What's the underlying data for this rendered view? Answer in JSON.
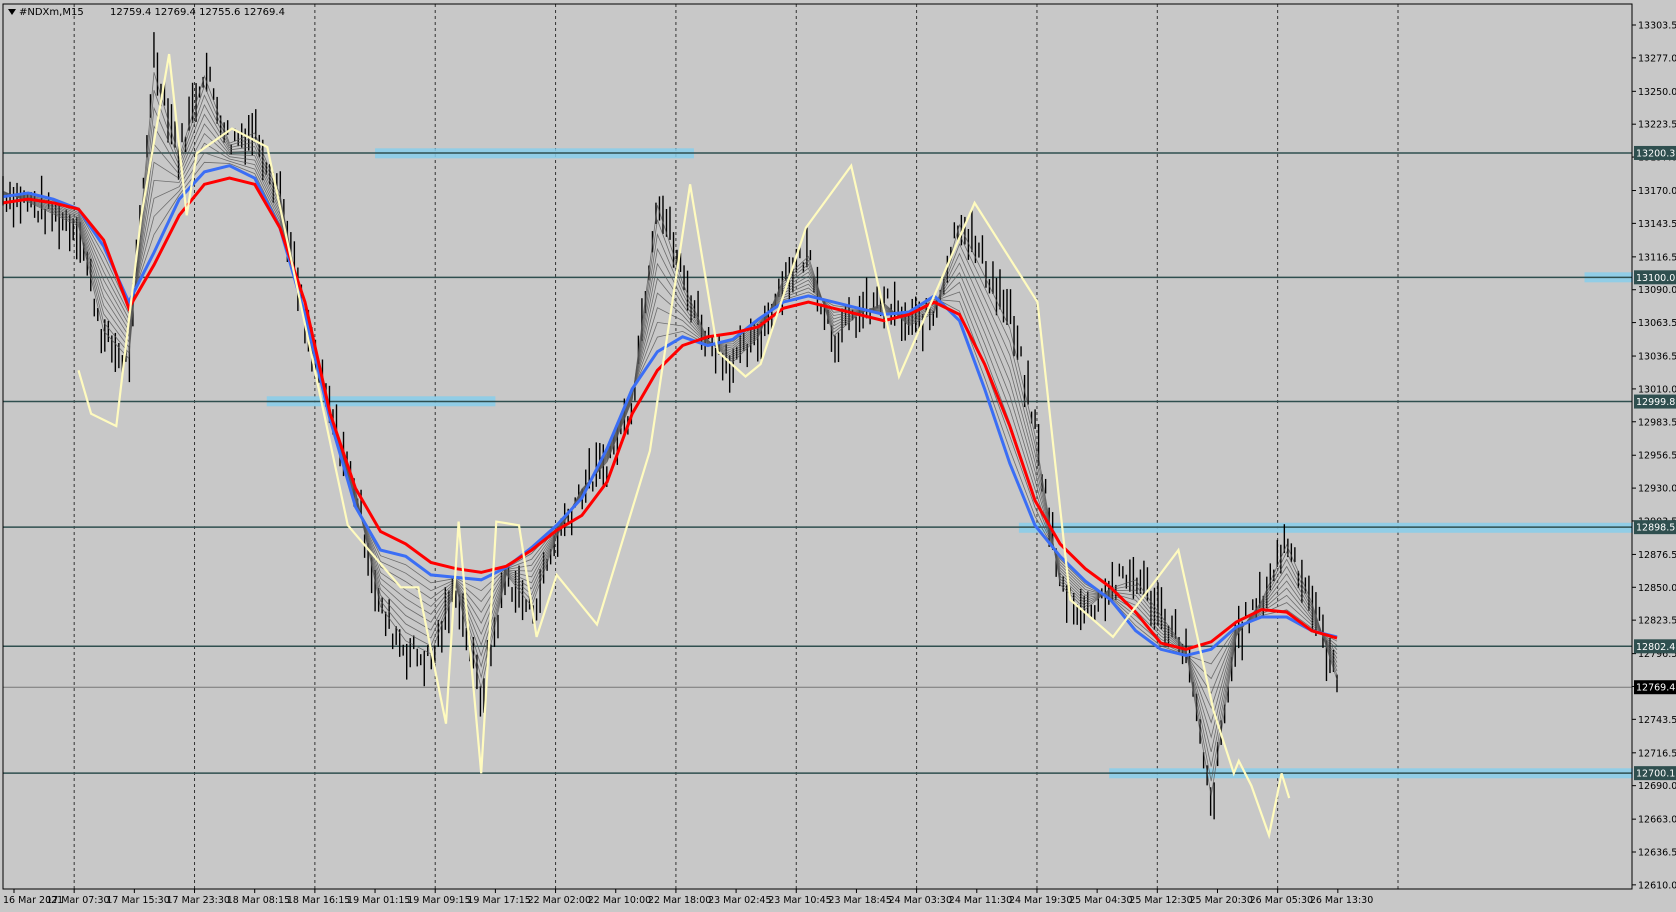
{
  "header": {
    "symbol_timeframe": "#NDXm,M15",
    "ohlc": "12759.4 12769.4 12755.6 12769.4"
  },
  "chart_data": {
    "type": "candlestick",
    "ylim": [
      12610,
      13310
    ],
    "grid": true,
    "background": "#c8c8c8",
    "colors": {
      "bars": "#000000",
      "ema_red": "#ff0000",
      "ema_blue": "#3b6ef5",
      "guppy": "#555555",
      "zigzag": "#fffbbf",
      "zones": "#87ceeb",
      "level_lines": "#2f4f4f"
    },
    "y_ticks": [
      "12610.0",
      "12636.5",
      "12663.0",
      "12690.0",
      "12716.5",
      "12743.5",
      "12770.0",
      "12796.5",
      "12823.5",
      "12850.0",
      "12876.5",
      "12903.5",
      "12930.0",
      "12956.5",
      "12983.5",
      "13010.0",
      "13036.5",
      "13063.5",
      "13090.0",
      "13116.5",
      "13143.5",
      "13170.0",
      "13197.0",
      "13223.5",
      "13250.0",
      "13277.0",
      "13303.5"
    ],
    "x_ticks": [
      "16 Mar 2021",
      "17 Mar 07:30",
      "17 Mar 15:30",
      "17 Mar 23:30",
      "18 Mar 08:15",
      "18 Mar 16:15",
      "19 Mar 01:15",
      "19 Mar 09:15",
      "19 Mar 17:15",
      "22 Mar 02:00",
      "22 Mar 10:00",
      "22 Mar 18:00",
      "23 Mar 02:45",
      "23 Mar 10:45",
      "23 Mar 18:45",
      "24 Mar 03:30",
      "24 Mar 11:30",
      "24 Mar 19:30",
      "25 Mar 04:30",
      "25 Mar 12:30",
      "25 Mar 20:30",
      "26 Mar 05:30",
      "26 Mar 13:30"
    ],
    "levels": [
      {
        "price": 13200.3,
        "label": "13200.3"
      },
      {
        "price": 13100.0,
        "label": "13100.0"
      },
      {
        "price": 12999.8,
        "label": "12999.8"
      },
      {
        "price": 12898.5,
        "label": "12898.5"
      },
      {
        "price": 12802.4,
        "label": "12802.4"
      },
      {
        "price": 12700.1,
        "label": "12700.1"
      }
    ],
    "current_price": {
      "price": 12769.4,
      "label": "12769.4"
    },
    "zones": [
      {
        "price": 13200,
        "from": 6,
        "to": 11.3
      },
      {
        "price": 13100,
        "from": 26.1,
        "to": 41.2
      },
      {
        "price": 13000,
        "from": 4.2,
        "to": 8.0
      },
      {
        "price": 13000,
        "from": 33.8,
        "to": 42.4
      },
      {
        "price": 12898,
        "from": 16.7,
        "to": 55.0
      },
      {
        "price": 12700,
        "from": 18.2,
        "to": 56.1
      }
    ],
    "price_path": [
      [
        0,
        13170
      ],
      [
        1,
        13160
      ],
      [
        2,
        13150
      ],
      [
        3,
        13140
      ],
      [
        4,
        13050
      ],
      [
        5,
        13030
      ],
      [
        6,
        13280
      ],
      [
        7,
        13200
      ],
      [
        8,
        13270
      ],
      [
        9,
        13210
      ],
      [
        10,
        13220
      ],
      [
        11,
        13170
      ],
      [
        12,
        13060
      ],
      [
        13,
        12990
      ],
      [
        14,
        12930
      ],
      [
        15,
        12830
      ],
      [
        16,
        12800
      ],
      [
        17,
        12790
      ],
      [
        18,
        12850
      ],
      [
        19,
        12760
      ],
      [
        20,
        12860
      ],
      [
        21,
        12830
      ],
      [
        22,
        12890
      ],
      [
        23,
        12930
      ],
      [
        24,
        12950
      ],
      [
        25,
        13000
      ],
      [
        26,
        13170
      ],
      [
        27,
        13100
      ],
      [
        28,
        13050
      ],
      [
        29,
        13030
      ],
      [
        30,
        13050
      ],
      [
        31,
        13100
      ],
      [
        32,
        13120
      ],
      [
        33,
        13050
      ],
      [
        34,
        13070
      ],
      [
        35,
        13080
      ],
      [
        36,
        13060
      ],
      [
        37,
        13070
      ],
      [
        38,
        13150
      ],
      [
        39,
        13110
      ],
      [
        40,
        13070
      ],
      [
        41,
        12980
      ],
      [
        42,
        12850
      ],
      [
        43,
        12830
      ],
      [
        44,
        12850
      ],
      [
        45,
        12860
      ],
      [
        46,
        12830
      ],
      [
        47,
        12800
      ],
      [
        48,
        12670
      ],
      [
        49,
        12810
      ],
      [
        50,
        12840
      ],
      [
        51,
        12890
      ],
      [
        52,
        12840
      ],
      [
        53,
        12772
      ]
    ],
    "ema_red": [
      [
        0,
        13160
      ],
      [
        1,
        13163
      ],
      [
        2,
        13160
      ],
      [
        3,
        13155
      ],
      [
        4,
        13130
      ],
      [
        5,
        13075
      ],
      [
        6,
        13110
      ],
      [
        7,
        13150
      ],
      [
        8,
        13175
      ],
      [
        9,
        13180
      ],
      [
        10,
        13175
      ],
      [
        11,
        13140
      ],
      [
        12,
        13080
      ],
      [
        13,
        12990
      ],
      [
        14,
        12930
      ],
      [
        15,
        12895
      ],
      [
        16,
        12885
      ],
      [
        17,
        12870
      ],
      [
        18,
        12865
      ],
      [
        19,
        12862
      ],
      [
        20,
        12867
      ],
      [
        21,
        12880
      ],
      [
        22,
        12896
      ],
      [
        23,
        12908
      ],
      [
        24,
        12935
      ],
      [
        25,
        12990
      ],
      [
        26,
        13025
      ],
      [
        27,
        13045
      ],
      [
        28,
        13052
      ],
      [
        29,
        13055
      ],
      [
        30,
        13060
      ],
      [
        31,
        13075
      ],
      [
        32,
        13080
      ],
      [
        33,
        13075
      ],
      [
        34,
        13070
      ],
      [
        35,
        13065
      ],
      [
        36,
        13070
      ],
      [
        37,
        13080
      ],
      [
        38,
        13070
      ],
      [
        39,
        13030
      ],
      [
        40,
        12980
      ],
      [
        41,
        12920
      ],
      [
        42,
        12885
      ],
      [
        43,
        12865
      ],
      [
        44,
        12850
      ],
      [
        45,
        12830
      ],
      [
        46,
        12805
      ],
      [
        47,
        12800
      ],
      [
        48,
        12806
      ],
      [
        49,
        12822
      ],
      [
        50,
        12832
      ],
      [
        51,
        12830
      ],
      [
        52,
        12815
      ],
      [
        53,
        12809
      ]
    ],
    "ema_blue": [
      [
        0,
        13165
      ],
      [
        1,
        13168
      ],
      [
        2,
        13163
      ],
      [
        3,
        13155
      ],
      [
        4,
        13125
      ],
      [
        5,
        13080
      ],
      [
        6,
        13120
      ],
      [
        7,
        13163
      ],
      [
        8,
        13185
      ],
      [
        9,
        13190
      ],
      [
        10,
        13180
      ],
      [
        11,
        13140
      ],
      [
        12,
        13070
      ],
      [
        13,
        12985
      ],
      [
        14,
        12915
      ],
      [
        15,
        12880
      ],
      [
        16,
        12875
      ],
      [
        17,
        12860
      ],
      [
        18,
        12858
      ],
      [
        19,
        12856
      ],
      [
        20,
        12866
      ],
      [
        21,
        12882
      ],
      [
        22,
        12900
      ],
      [
        23,
        12922
      ],
      [
        24,
        12962
      ],
      [
        25,
        13010
      ],
      [
        26,
        13040
      ],
      [
        27,
        13052
      ],
      [
        28,
        13045
      ],
      [
        29,
        13050
      ],
      [
        30,
        13066
      ],
      [
        31,
        13080
      ],
      [
        32,
        13085
      ],
      [
        33,
        13080
      ],
      [
        34,
        13075
      ],
      [
        35,
        13070
      ],
      [
        36,
        13072
      ],
      [
        37,
        13085
      ],
      [
        38,
        13065
      ],
      [
        39,
        13010
      ],
      [
        40,
        12950
      ],
      [
        41,
        12900
      ],
      [
        42,
        12875
      ],
      [
        43,
        12855
      ],
      [
        44,
        12840
      ],
      [
        45,
        12815
      ],
      [
        46,
        12800
      ],
      [
        47,
        12795
      ],
      [
        48,
        12800
      ],
      [
        49,
        12818
      ],
      [
        50,
        12826
      ],
      [
        51,
        12826
      ],
      [
        52,
        12815
      ],
      [
        53,
        12810
      ]
    ],
    "zigzag": [
      [
        3,
        13025
      ],
      [
        3.5,
        12990
      ],
      [
        4.5,
        12980
      ],
      [
        5.5,
        13150
      ],
      [
        6.6,
        13280
      ],
      [
        7.3,
        13150
      ],
      [
        7.7,
        13200
      ],
      [
        9.1,
        13220
      ],
      [
        10.5,
        13205
      ],
      [
        11.6,
        13100
      ],
      [
        13.7,
        12900
      ],
      [
        15.8,
        12850
      ],
      [
        16.5,
        12850
      ],
      [
        17.6,
        12740
      ],
      [
        18.1,
        12903
      ],
      [
        19.0,
        12700
      ],
      [
        19.6,
        12903
      ],
      [
        20.5,
        12900
      ],
      [
        21.2,
        12810
      ],
      [
        22.0,
        12860
      ],
      [
        23.6,
        12820
      ],
      [
        25.7,
        12960
      ],
      [
        27.3,
        13175
      ],
      [
        28.4,
        13040
      ],
      [
        29.5,
        13020
      ],
      [
        30.1,
        13030
      ],
      [
        31.9,
        13140
      ],
      [
        33.7,
        13190
      ],
      [
        35.6,
        13020
      ],
      [
        38.6,
        13160
      ],
      [
        41.1,
        13080
      ],
      [
        42.4,
        12840
      ],
      [
        44.1,
        12810
      ],
      [
        46.7,
        12880
      ],
      [
        48.1,
        12750
      ],
      [
        48.9,
        12700
      ],
      [
        49.1,
        12710
      ],
      [
        49.6,
        12690
      ],
      [
        50.3,
        12650
      ],
      [
        50.8,
        12700
      ],
      [
        51.1,
        12680
      ]
    ]
  }
}
